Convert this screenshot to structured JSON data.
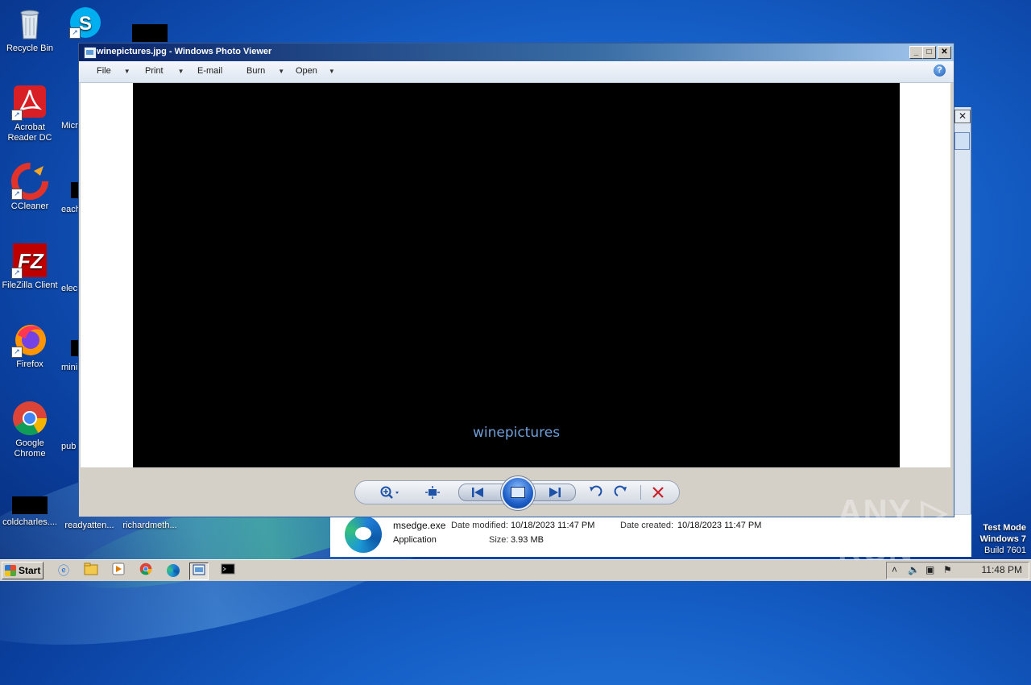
{
  "desktop": {
    "icons": [
      {
        "label": "Recycle Bin",
        "icon": "recycle-bin-icon"
      },
      {
        "label": "Acrobat Reader DC",
        "icon": "acrobat-icon"
      },
      {
        "label": "CCleaner",
        "icon": "ccleaner-icon"
      },
      {
        "label": "FileZilla Client",
        "icon": "filezilla-icon"
      },
      {
        "label": "Firefox",
        "icon": "firefox-icon"
      },
      {
        "label": "Google Chrome",
        "icon": "chrome-icon"
      },
      {
        "label": "coldcharles....",
        "icon": "file-icon"
      }
    ],
    "partial_icons": [
      {
        "label": "Micr",
        "icon": "edge-icon"
      },
      {
        "label": "each",
        "icon": "file-icon"
      },
      {
        "label": "elec",
        "icon": "file-icon"
      },
      {
        "label": "mini",
        "icon": "file-icon"
      },
      {
        "label": "pub",
        "icon": "file-icon"
      },
      {
        "label": "readyatten...",
        "icon": "file-icon"
      },
      {
        "label": "richardmeth...",
        "icon": "file-icon"
      }
    ],
    "skype_icon": "skype-icon"
  },
  "window": {
    "title": "winepictures.jpg - Windows Photo Viewer",
    "menu": [
      {
        "label": "File",
        "has_dropdown": true
      },
      {
        "label": "Print",
        "has_dropdown": true
      },
      {
        "label": "E-mail",
        "has_dropdown": false
      },
      {
        "label": "Burn",
        "has_dropdown": true
      },
      {
        "label": "Open",
        "has_dropdown": true
      }
    ],
    "help_label": "?",
    "caption": "winepictures",
    "controls": {
      "minimize": "_",
      "maximize": "□",
      "close": "✕"
    }
  },
  "file_info": {
    "name": "msedge.exe",
    "type": "Application",
    "date_modified_label": "Date modified:",
    "date_modified": "10/18/2023 11:47 PM",
    "size_label": "Size:",
    "size": "3.93 MB",
    "date_created_label": "Date created:",
    "date_created": "10/18/2023 11:47 PM"
  },
  "watermark": {
    "text": "ANY ▷ RUN",
    "test_mode": "Test Mode",
    "os": "Windows 7",
    "build": "Build 7601"
  },
  "taskbar": {
    "start_label": "Start",
    "clock": "11:48 PM"
  }
}
